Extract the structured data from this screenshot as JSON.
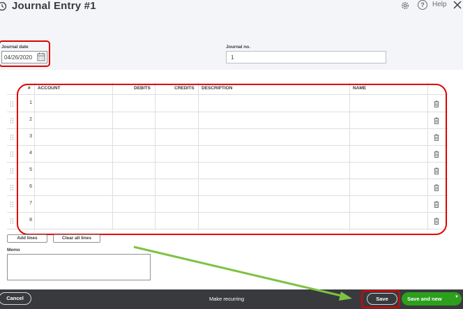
{
  "header": {
    "title": "Journal Entry #1",
    "help_label": "Help"
  },
  "form": {
    "journal_date_label": "Journal date",
    "journal_date_value": "04/26/2020",
    "journal_no_label": "Journal no.",
    "journal_no_value": "1"
  },
  "table": {
    "columns": [
      "#",
      "ACCOUNT",
      "DEBITS",
      "CREDITS",
      "DESCRIPTION",
      "NAME"
    ],
    "rows": [
      "1",
      "2",
      "3",
      "4",
      "5",
      "6",
      "7",
      "8"
    ]
  },
  "actions": {
    "add_lines": "Add lines",
    "clear_all_lines": "Clear all lines"
  },
  "memo": {
    "label": "Memo"
  },
  "footer": {
    "cancel": "Cancel",
    "make_recurring": "Make recurring",
    "save": "Save",
    "save_and_new": "Save and new"
  },
  "colors": {
    "annotation": "#e00000",
    "arrow": "#7dc242",
    "primary": "#2ca01c",
    "footer_bg": "#393a3d"
  }
}
